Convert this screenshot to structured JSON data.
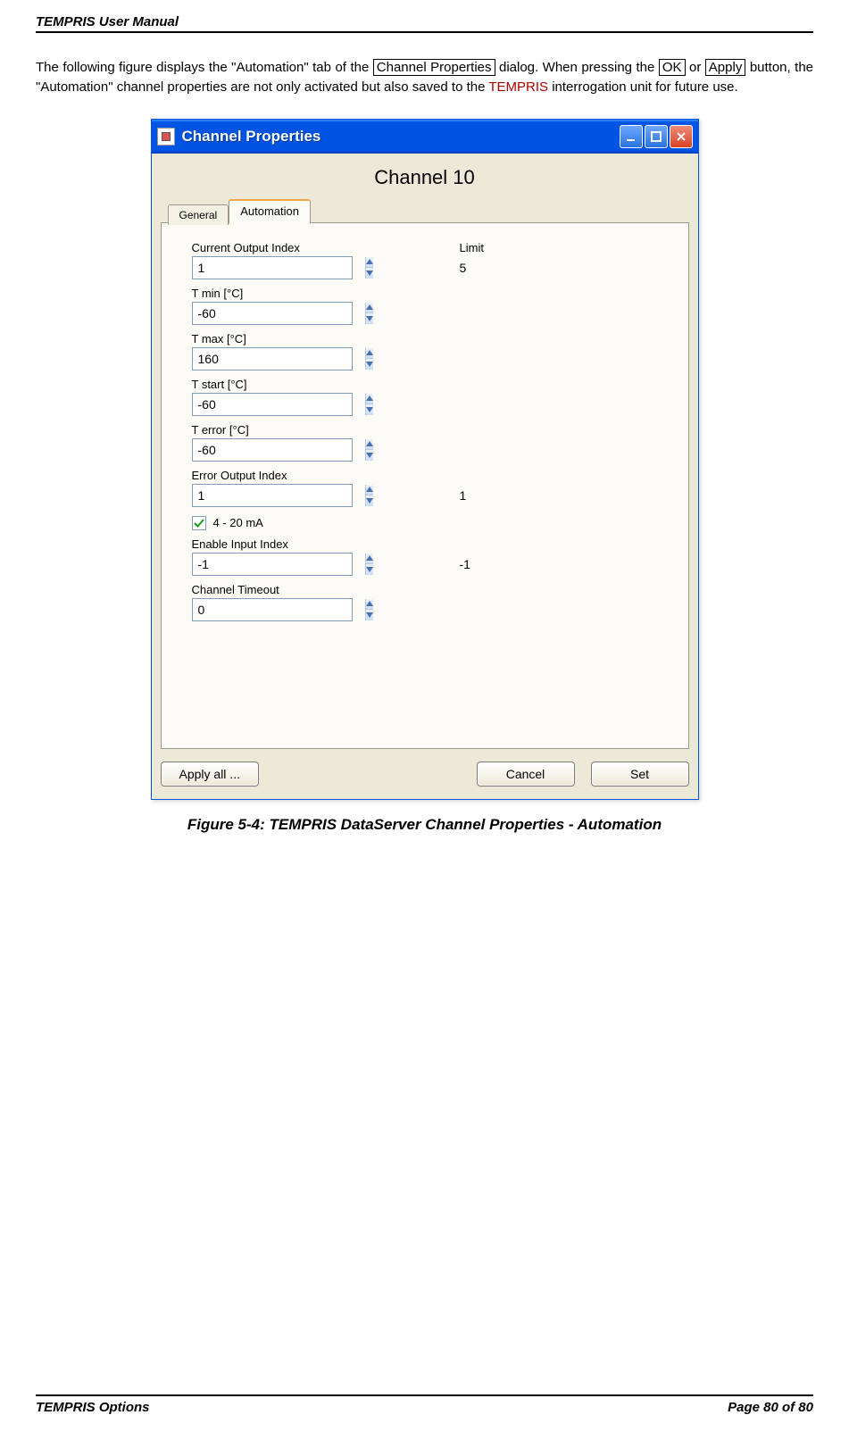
{
  "header": {
    "title": "TEMPRIS User Manual"
  },
  "intro": {
    "pre": "The following figure displays the \"Automation\" tab of the ",
    "box1": "Channel Properties",
    "mid1": " dialog. When pressing the ",
    "box2": "OK",
    "mid2": " or ",
    "box3": "Apply",
    "mid3": " button, the \"Automation\" channel properties are not only activated but also saved to the ",
    "brand": "TEMPRIS",
    "post": " interrogation unit for future use."
  },
  "window": {
    "title": "Channel Properties",
    "channel_title": "Channel 10",
    "tab_general": "General",
    "tab_automation": "Automation",
    "label_limit": "Limit",
    "fields": {
      "coi": {
        "label": "Current Output Index",
        "value": "1",
        "side": "5"
      },
      "tmin": {
        "label": "T min [°C]",
        "value": "-60"
      },
      "tmax": {
        "label": "T max [°C]",
        "value": "160"
      },
      "tstart": {
        "label": "T start [°C]",
        "value": "-60"
      },
      "terror": {
        "label": "T error [°C]",
        "value": "-60"
      },
      "eoi": {
        "label": "Error Output Index",
        "value": "1",
        "side": "1"
      },
      "check": {
        "label": "4 - 20 mA"
      },
      "eii": {
        "label": "Enable Input Index",
        "value": "-1",
        "side": "-1"
      },
      "cto": {
        "label": "Channel Timeout",
        "value": "0"
      }
    },
    "buttons": {
      "apply_all": "Apply all ...",
      "cancel": "Cancel",
      "set": "Set"
    }
  },
  "caption": "Figure 5-4: TEMPRIS DataServer Channel Properties - Automation",
  "footer": {
    "left": "TEMPRIS Options",
    "right": "Page 80 of 80"
  }
}
